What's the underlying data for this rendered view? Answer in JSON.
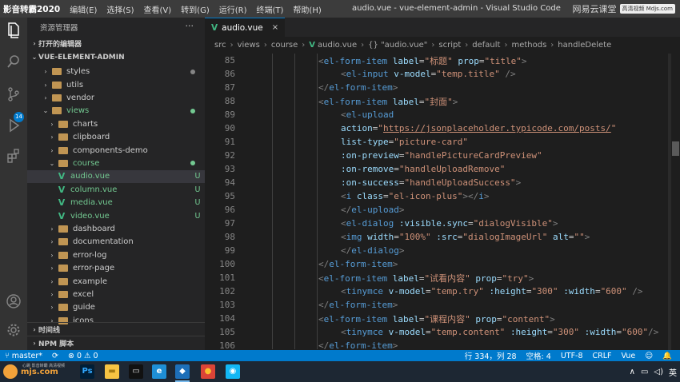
{
  "titlebar": {
    "brand": "影音转霸2020",
    "menu": [
      "编辑(E)",
      "选择(S)",
      "查看(V)",
      "转到(G)",
      "运行(R)",
      "终端(T)",
      "帮助(H)"
    ],
    "window_title": "audio.vue - vue-element-admin - Visual Studio Code",
    "watermark": {
      "logo": "网易云课堂",
      "box": "高清视频 Mdjs.com"
    }
  },
  "activity_bar": {
    "badge": "14",
    "icons": [
      "files-icon",
      "search-icon",
      "source-control-icon",
      "run-debug-icon",
      "extensions-icon",
      "account-icon",
      "settings-gear-icon"
    ]
  },
  "sidebar": {
    "title": "资源管理器",
    "more": "···",
    "open_editors": "打开的编辑器",
    "project": "VUE-ELEMENT-ADMIN",
    "items": [
      {
        "label": "styles",
        "kind": "folder",
        "level": 1,
        "expanded": false,
        "status_dot": "#858585",
        "color": "#ccc"
      },
      {
        "label": "utils",
        "kind": "folder",
        "level": 1,
        "expanded": false,
        "color": "#ccc"
      },
      {
        "label": "vendor",
        "kind": "folder",
        "level": 1,
        "expanded": false,
        "color": "#ccc"
      },
      {
        "label": "views",
        "kind": "folder",
        "level": 1,
        "expanded": true,
        "status_dot": "#73c991",
        "color": "#73c991"
      },
      {
        "label": "charts",
        "kind": "folder",
        "level": 2,
        "expanded": false,
        "color": "#ccc"
      },
      {
        "label": "clipboard",
        "kind": "folder",
        "level": 2,
        "expanded": false,
        "color": "#ccc"
      },
      {
        "label": "components-demo",
        "kind": "folder",
        "level": 2,
        "expanded": false,
        "color": "#ccc"
      },
      {
        "label": "course",
        "kind": "folder",
        "level": 2,
        "expanded": true,
        "status_dot": "#73c991",
        "color": "#73c991"
      },
      {
        "label": "audio.vue",
        "kind": "vue",
        "level": 3,
        "status": "U",
        "selected": true,
        "color": "#73c991"
      },
      {
        "label": "column.vue",
        "kind": "vue",
        "level": 3,
        "status": "U",
        "color": "#73c991"
      },
      {
        "label": "media.vue",
        "kind": "vue",
        "level": 3,
        "status": "U",
        "color": "#73c991"
      },
      {
        "label": "video.vue",
        "kind": "vue",
        "level": 3,
        "status": "U",
        "color": "#73c991"
      },
      {
        "label": "dashboard",
        "kind": "folder",
        "level": 2,
        "expanded": false,
        "color": "#ccc"
      },
      {
        "label": "documentation",
        "kind": "folder",
        "level": 2,
        "expanded": false,
        "color": "#ccc"
      },
      {
        "label": "error-log",
        "kind": "folder",
        "level": 2,
        "expanded": false,
        "color": "#ccc"
      },
      {
        "label": "error-page",
        "kind": "folder",
        "level": 2,
        "expanded": false,
        "color": "#ccc"
      },
      {
        "label": "example",
        "kind": "folder",
        "level": 2,
        "expanded": false,
        "color": "#ccc"
      },
      {
        "label": "excel",
        "kind": "folder",
        "level": 2,
        "expanded": false,
        "color": "#ccc"
      },
      {
        "label": "guide",
        "kind": "folder",
        "level": 2,
        "expanded": false,
        "color": "#ccc"
      },
      {
        "label": "icons",
        "kind": "folder",
        "level": 2,
        "expanded": false,
        "color": "#ccc"
      }
    ],
    "timeline": "时间线",
    "npm_scripts": "NPM 脚本"
  },
  "editor": {
    "tab": {
      "label": "audio.vue"
    },
    "breadcrumb": [
      "src",
      "views",
      "course",
      "audio.vue",
      "{} \"audio.vue\"",
      "script",
      "default",
      "methods",
      "handleDelete"
    ],
    "lines": [
      {
        "n": "85",
        "indent": 2,
        "tokens": [
          [
            "tag",
            "<"
          ],
          [
            "tn",
            "el-form-item"
          ],
          [
            "t",
            " "
          ],
          [
            "at",
            "label"
          ],
          [
            "t",
            "="
          ],
          [
            "st",
            "\"标题\""
          ],
          [
            "t",
            " "
          ],
          [
            "at",
            "prop"
          ],
          [
            "t",
            "="
          ],
          [
            "st",
            "\"title\""
          ],
          [
            "tag",
            ">"
          ]
        ]
      },
      {
        "n": "86",
        "indent": 3,
        "tokens": [
          [
            "tag",
            "<"
          ],
          [
            "tn",
            "el-input"
          ],
          [
            "t",
            " "
          ],
          [
            "at",
            "v-model"
          ],
          [
            "t",
            "="
          ],
          [
            "st",
            "\"temp.title\""
          ],
          [
            "t",
            " "
          ],
          [
            "tag",
            "/>"
          ]
        ]
      },
      {
        "n": "87",
        "indent": 2,
        "tokens": [
          [
            "tag",
            "</"
          ],
          [
            "tn",
            "el-form-item"
          ],
          [
            "tag",
            ">"
          ]
        ]
      },
      {
        "n": "88",
        "indent": 2,
        "tokens": [
          [
            "tag",
            "<"
          ],
          [
            "tn",
            "el-form-item"
          ],
          [
            "t",
            " "
          ],
          [
            "at",
            "label"
          ],
          [
            "t",
            "="
          ],
          [
            "st",
            "\"封面\""
          ],
          [
            "tag",
            ">"
          ]
        ]
      },
      {
        "n": "89",
        "indent": 3,
        "tokens": [
          [
            "tag",
            "<"
          ],
          [
            "tn",
            "el-upload"
          ]
        ]
      },
      {
        "n": "90",
        "indent": 3,
        "tokens": [
          [
            "at",
            "action"
          ],
          [
            "t",
            "="
          ],
          [
            "st",
            "\""
          ],
          [
            "url",
            "https://jsonplaceholder.typicode.com/posts/"
          ],
          [
            "st",
            "\""
          ]
        ]
      },
      {
        "n": "91",
        "indent": 3,
        "tokens": [
          [
            "at",
            "list-type"
          ],
          [
            "t",
            "="
          ],
          [
            "st",
            "\"picture-card\""
          ]
        ]
      },
      {
        "n": "92",
        "indent": 3,
        "tokens": [
          [
            "at",
            ":on-preview"
          ],
          [
            "t",
            "="
          ],
          [
            "st",
            "\"handlePictureCardPreview\""
          ]
        ]
      },
      {
        "n": "93",
        "indent": 3,
        "tokens": [
          [
            "at",
            ":on-remove"
          ],
          [
            "t",
            "="
          ],
          [
            "st",
            "\"handleUploadRemove\""
          ]
        ]
      },
      {
        "n": "94",
        "indent": 3,
        "tokens": [
          [
            "at",
            ":on-success"
          ],
          [
            "t",
            "="
          ],
          [
            "st",
            "\"handleUploadSuccess\""
          ],
          [
            "tag",
            ">"
          ]
        ]
      },
      {
        "n": "95",
        "indent": 3,
        "tokens": [
          [
            "tag",
            "<"
          ],
          [
            "tn",
            "i"
          ],
          [
            "t",
            " "
          ],
          [
            "at",
            "class"
          ],
          [
            "t",
            "="
          ],
          [
            "st",
            "\"el-icon-plus\""
          ],
          [
            "tag",
            "></"
          ],
          [
            "tn",
            "i"
          ],
          [
            "tag",
            ">"
          ]
        ]
      },
      {
        "n": "96",
        "indent": 3,
        "tokens": [
          [
            "tag",
            "</"
          ],
          [
            "tn",
            "el-upload"
          ],
          [
            "tag",
            ">"
          ]
        ]
      },
      {
        "n": "97",
        "indent": 3,
        "tokens": [
          [
            "tag",
            "<"
          ],
          [
            "tn",
            "el-dialog"
          ],
          [
            "t",
            " "
          ],
          [
            "at",
            ":visible.sync"
          ],
          [
            "t",
            "="
          ],
          [
            "st",
            "\"dialogVisible\""
          ],
          [
            "tag",
            ">"
          ]
        ]
      },
      {
        "n": "98",
        "indent": 3,
        "tokens": [
          [
            "tag",
            "<"
          ],
          [
            "tn",
            "img"
          ],
          [
            "t",
            " "
          ],
          [
            "at",
            "width"
          ],
          [
            "t",
            "="
          ],
          [
            "st",
            "\"100%\""
          ],
          [
            "t",
            " "
          ],
          [
            "at",
            ":src"
          ],
          [
            "t",
            "="
          ],
          [
            "st",
            "\"dialogImageUrl\""
          ],
          [
            "t",
            " "
          ],
          [
            "at",
            "alt"
          ],
          [
            "t",
            "="
          ],
          [
            "st",
            "\"\""
          ],
          [
            "tag",
            ">"
          ]
        ]
      },
      {
        "n": "99",
        "indent": 3,
        "tokens": [
          [
            "tag",
            "</"
          ],
          [
            "tn",
            "el-dialog"
          ],
          [
            "tag",
            ">"
          ]
        ]
      },
      {
        "n": "100",
        "indent": 2,
        "tokens": [
          [
            "tag",
            "</"
          ],
          [
            "tn",
            "el-form-item"
          ],
          [
            "tag",
            ">"
          ]
        ]
      },
      {
        "n": "101",
        "indent": 2,
        "tokens": [
          [
            "tag",
            "<"
          ],
          [
            "tn",
            "el-form-item"
          ],
          [
            "t",
            " "
          ],
          [
            "at",
            "label"
          ],
          [
            "t",
            "="
          ],
          [
            "st",
            "\"试看内容\""
          ],
          [
            "t",
            " "
          ],
          [
            "at",
            "prop"
          ],
          [
            "t",
            "="
          ],
          [
            "st",
            "\"try\""
          ],
          [
            "tag",
            ">"
          ]
        ]
      },
      {
        "n": "102",
        "indent": 3,
        "tokens": [
          [
            "tag",
            "<"
          ],
          [
            "tn",
            "tinymce"
          ],
          [
            "t",
            " "
          ],
          [
            "at",
            "v-model"
          ],
          [
            "t",
            "="
          ],
          [
            "st",
            "\"temp.try\""
          ],
          [
            "t",
            " "
          ],
          [
            "at",
            ":height"
          ],
          [
            "t",
            "="
          ],
          [
            "st",
            "\"300\""
          ],
          [
            "t",
            " "
          ],
          [
            "at",
            ":width"
          ],
          [
            "t",
            "="
          ],
          [
            "st",
            "\"600\""
          ],
          [
            "t",
            " "
          ],
          [
            "tag",
            "/>"
          ]
        ]
      },
      {
        "n": "103",
        "indent": 2,
        "tokens": [
          [
            "tag",
            "</"
          ],
          [
            "tn",
            "el-form-item"
          ],
          [
            "tag",
            ">"
          ]
        ]
      },
      {
        "n": "104",
        "indent": 2,
        "tokens": [
          [
            "tag",
            "<"
          ],
          [
            "tn",
            "el-form-item"
          ],
          [
            "t",
            " "
          ],
          [
            "at",
            "label"
          ],
          [
            "t",
            "="
          ],
          [
            "st",
            "\"课程内容\""
          ],
          [
            "t",
            " "
          ],
          [
            "at",
            "prop"
          ],
          [
            "t",
            "="
          ],
          [
            "st",
            "\"content\""
          ],
          [
            "tag",
            ">"
          ]
        ]
      },
      {
        "n": "105",
        "indent": 3,
        "tokens": [
          [
            "tag",
            "<"
          ],
          [
            "tn",
            "tinymce"
          ],
          [
            "t",
            " "
          ],
          [
            "at",
            "v-model"
          ],
          [
            "t",
            "="
          ],
          [
            "st",
            "\"temp.content\""
          ],
          [
            "t",
            " "
          ],
          [
            "at",
            ":height"
          ],
          [
            "t",
            "="
          ],
          [
            "st",
            "\"300\""
          ],
          [
            "t",
            " "
          ],
          [
            "at",
            ":width"
          ],
          [
            "t",
            "="
          ],
          [
            "st",
            "\"600\""
          ],
          [
            "tag",
            "/>"
          ]
        ]
      },
      {
        "n": "106",
        "indent": 2,
        "tokens": [
          [
            "tag",
            "</"
          ],
          [
            "tn",
            "el-form-item"
          ],
          [
            "tag",
            ">"
          ]
        ]
      }
    ]
  },
  "statusbar": {
    "branch": "master*",
    "sync": "⟳",
    "problems": "⊗ 0 ⚠ 0",
    "position": "行 334，列 28",
    "spaces": "空格: 4",
    "encoding": "UTF-8",
    "eol": "CRLF",
    "language": "Vue",
    "feedback": "☺",
    "bell": "🔔"
  },
  "taskbar": {
    "site": "mjs.com",
    "mini_text": "心跳  影音转霸  高清视频",
    "apps": [
      {
        "name": "photoshop-icon",
        "label": "Ps",
        "bg": "#001e36",
        "fg": "#31a8ff"
      },
      {
        "name": "file-explorer-icon",
        "label": "▬",
        "bg": "#f6c343",
        "fg": "#a57b12"
      },
      {
        "name": "terminal-icon",
        "label": "▭",
        "bg": "#111",
        "fg": "#ddd"
      },
      {
        "name": "edge-icon",
        "label": "e",
        "bg": "#1e8fd6",
        "fg": "#fff"
      },
      {
        "name": "vscode-icon",
        "label": "◆",
        "bg": "#1d6fb8",
        "fg": "#fff"
      },
      {
        "name": "chrome-icon",
        "label": "●",
        "bg": "#db4437",
        "fg": "#fbc02d"
      },
      {
        "name": "qq-icon",
        "label": "◉",
        "bg": "#12b7f5",
        "fg": "#fff"
      }
    ],
    "ime": "英"
  }
}
